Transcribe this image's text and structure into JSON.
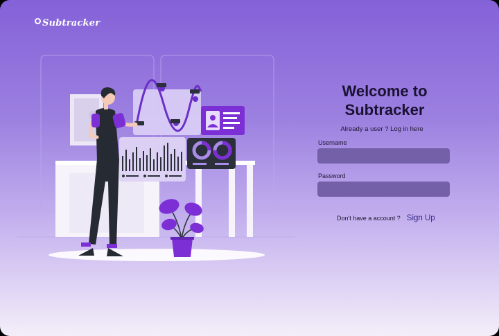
{
  "brand": {
    "name": "Subtracker"
  },
  "welcome": {
    "line1": "Welcome to",
    "line2": "Subtracker"
  },
  "login_prompt": "Already a user ? Log in here",
  "form": {
    "username_label": "Username",
    "username_value": "",
    "password_label": "Password",
    "password_value": ""
  },
  "signup": {
    "question": "Don't have a account ?",
    "link": "Sign Up"
  },
  "colors": {
    "gradient_top": "#8461d8",
    "gradient_bottom": "#f4eef9",
    "input_fill": "#7460a8",
    "accent_purple": "#7d2fd6",
    "figure_dark": "#252a33"
  }
}
